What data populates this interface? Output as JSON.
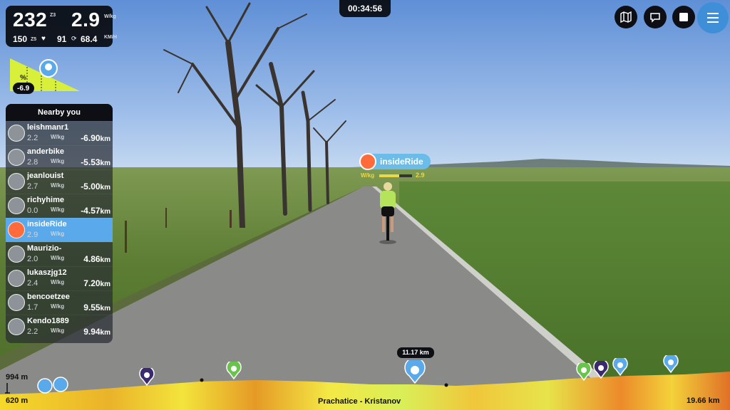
{
  "stats": {
    "power": "232",
    "power_zone": "Z3",
    "wkg": "2.9",
    "wkg_unit": "W/kg",
    "heart_rate": "150",
    "hr_zone": "Z5",
    "cadence": "91",
    "speed": "68.4",
    "speed_unit": "KM/H"
  },
  "timer": "00:34:56",
  "gradient": {
    "percent_symbol": "%",
    "value": "-6.9"
  },
  "nearby": {
    "title": "Nearby you",
    "riders": [
      {
        "name": "leishmanr1",
        "wkg": "2.2",
        "unit": "W/kg",
        "distance": "-6.90",
        "km": "km",
        "active": false
      },
      {
        "name": "anderbike",
        "wkg": "2.8",
        "unit": "W/kg",
        "distance": "-5.53",
        "km": "km",
        "active": false
      },
      {
        "name": "jeanlouist",
        "wkg": "2.7",
        "unit": "W/kg",
        "distance": "-5.00",
        "km": "km",
        "active": false
      },
      {
        "name": "richyhime",
        "wkg": "0.0",
        "unit": "W/kg",
        "distance": "-4.57",
        "km": "km",
        "active": false
      },
      {
        "name": "insideRide",
        "wkg": "2.9",
        "unit": "W/kg",
        "distance": "",
        "km": "",
        "active": true
      },
      {
        "name": "Maurizio-",
        "wkg": "2.0",
        "unit": "W/kg",
        "distance": "4.86",
        "km": "km",
        "active": false
      },
      {
        "name": "lukaszjg12",
        "wkg": "2.4",
        "unit": "W/kg",
        "distance": "7.20",
        "km": "km",
        "active": false
      },
      {
        "name": "bencoetzee",
        "wkg": "1.7",
        "unit": "W/kg",
        "distance": "9.55",
        "km": "km",
        "active": false
      },
      {
        "name": "Kendo1889",
        "wkg": "2.2",
        "unit": "W/kg",
        "distance": "9.94",
        "km": "km",
        "active": false
      }
    ]
  },
  "rider_tag": {
    "name": "insideRide",
    "wkg_label": "W/kg",
    "wkg": "2.9",
    "wkg_fraction": 0.6
  },
  "profile": {
    "max_elev": "994 m",
    "min_elev": "620 m",
    "route": "Prachatice - Kristanov",
    "total": "19.66 km",
    "current": "11.17 km"
  },
  "icons": {
    "toolbar": [
      "map-icon",
      "chat-icon",
      "stop-icon",
      "menu-icon"
    ]
  },
  "colors": {
    "accent": "#5aa9ea",
    "hud": "#0d0f14",
    "grade_fill": "#d8f03a"
  }
}
